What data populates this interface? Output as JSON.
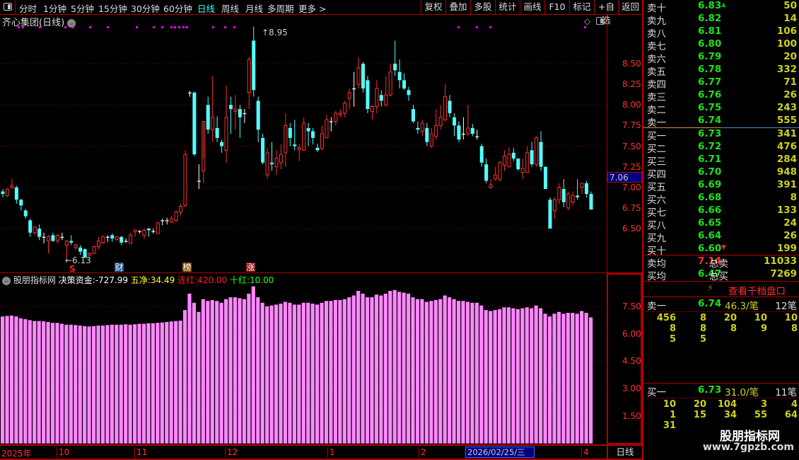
{
  "toolbar": {
    "periods": [
      "分时",
      "1分钟",
      "5分钟",
      "15分钟",
      "30分钟",
      "60分钟",
      "日线",
      "周线",
      "月线",
      "多周期",
      "更多 >"
    ],
    "active_period": "日线",
    "buttons": [
      "复权",
      "叠加",
      "多股",
      "统计",
      "画线",
      "F10",
      "标记",
      "+自选",
      "返回"
    ]
  },
  "chart": {
    "title": "齐心集团(日线)",
    "high_label": "8.95",
    "low_label": "6.13",
    "current_price_tag": "7.06",
    "price_ticks": [
      "8.50",
      "8.25",
      "8.00",
      "7.75",
      "7.50",
      "7.25",
      "7.00",
      "6.75",
      "6.50"
    ],
    "markers": [
      {
        "text": "S",
        "color": "#ff2020"
      },
      {
        "text": "财",
        "color": "#1a4f8a"
      },
      {
        "text": "榜",
        "color": "#8a4a10"
      },
      {
        "text": "涨",
        "color": "#8a1010"
      }
    ],
    "up_color": "#ff3030",
    "down_color": "#54ffff",
    "doji_color": "#ffffff",
    "signal_dot_color": "#ff00ff"
  },
  "chart_data": {
    "type": "candlestick",
    "ylim": [
      6.13,
      8.95
    ],
    "ohlc": [
      [
        6.95,
        6.98,
        6.88,
        6.92
      ],
      [
        6.9,
        6.99,
        6.88,
        6.98
      ],
      [
        7.0,
        7.1,
        6.98,
        7.02
      ],
      [
        7.0,
        7.02,
        6.8,
        6.85
      ],
      [
        6.85,
        6.86,
        6.72,
        6.78
      ],
      [
        6.72,
        6.74,
        6.62,
        6.65
      ],
      [
        6.6,
        6.62,
        6.4,
        6.45
      ],
      [
        6.45,
        6.53,
        6.42,
        6.52
      ],
      [
        6.5,
        6.55,
        6.36,
        6.4
      ],
      [
        6.4,
        6.45,
        6.32,
        6.4
      ],
      [
        6.35,
        6.42,
        6.2,
        6.4
      ],
      [
        6.42,
        6.45,
        6.34,
        6.35
      ],
      [
        6.35,
        6.43,
        6.32,
        6.42
      ],
      [
        6.4,
        6.45,
        6.36,
        6.4
      ],
      [
        6.3,
        6.36,
        6.13,
        6.35
      ],
      [
        6.35,
        6.42,
        6.3,
        6.33
      ],
      [
        6.27,
        6.32,
        6.24,
        6.3
      ],
      [
        6.27,
        6.3,
        6.18,
        6.22
      ],
      [
        6.25,
        6.26,
        6.14,
        6.15
      ],
      [
        6.18,
        6.21,
        6.15,
        6.2
      ],
      [
        6.2,
        6.29,
        6.19,
        6.28
      ],
      [
        6.28,
        6.4,
        6.25,
        6.35
      ],
      [
        6.33,
        6.42,
        6.31,
        6.4
      ],
      [
        6.4,
        6.42,
        6.34,
        6.4
      ],
      [
        6.42,
        6.44,
        6.34,
        6.38
      ],
      [
        6.37,
        6.41,
        6.35,
        6.4
      ],
      [
        6.4,
        6.41,
        6.3,
        6.33
      ],
      [
        6.35,
        6.38,
        6.33,
        6.35
      ],
      [
        6.32,
        6.45,
        6.32,
        6.42
      ],
      [
        6.46,
        6.49,
        6.4,
        6.48
      ],
      [
        6.47,
        6.48,
        6.44,
        6.47
      ],
      [
        6.42,
        6.5,
        6.37,
        6.48
      ],
      [
        6.5,
        6.51,
        6.4,
        6.48
      ],
      [
        6.47,
        6.5,
        6.44,
        6.47
      ],
      [
        6.44,
        6.58,
        6.44,
        6.57
      ],
      [
        6.6,
        6.62,
        6.54,
        6.6
      ],
      [
        6.6,
        6.63,
        6.55,
        6.6
      ],
      [
        6.58,
        6.65,
        6.57,
        6.62
      ],
      [
        6.6,
        6.72,
        6.58,
        6.7
      ],
      [
        6.7,
        6.8,
        6.66,
        6.77
      ],
      [
        6.78,
        7.45,
        6.76,
        7.4
      ],
      [
        8.15,
        8.17,
        8.1,
        8.15
      ],
      [
        8.15,
        8.16,
        7.38,
        7.4
      ],
      [
        7.08,
        7.28,
        6.98,
        7.08
      ],
      [
        7.2,
        7.35,
        7.05,
        7.8
      ],
      [
        8.0,
        8.1,
        7.65,
        7.7
      ],
      [
        7.7,
        8.35,
        7.55,
        7.85
      ],
      [
        7.72,
        7.86,
        7.55,
        7.6
      ],
      [
        7.55,
        7.58,
        7.42,
        7.5
      ],
      [
        7.45,
        8.23,
        7.3,
        7.85
      ],
      [
        8.0,
        8.1,
        7.65,
        7.95
      ],
      [
        7.92,
        8.12,
        7.7,
        7.95
      ],
      [
        7.95,
        8.0,
        7.6,
        7.85
      ],
      [
        7.9,
        7.95,
        7.78,
        7.9
      ],
      [
        8.15,
        8.58,
        7.95,
        8.55
      ],
      [
        8.78,
        8.95,
        8.1,
        8.18
      ],
      [
        8.05,
        8.1,
        7.55,
        7.7
      ],
      [
        7.6,
        7.65,
        7.28,
        7.3
      ],
      [
        7.15,
        7.48,
        7.1,
        7.42
      ],
      [
        7.3,
        7.55,
        7.2,
        7.28
      ],
      [
        7.25,
        7.45,
        7.15,
        7.35
      ],
      [
        7.3,
        7.52,
        7.22,
        7.4
      ],
      [
        7.42,
        7.9,
        7.25,
        7.75
      ],
      [
        7.72,
        7.78,
        7.5,
        7.6
      ],
      [
        7.52,
        7.82,
        7.45,
        7.5
      ],
      [
        7.46,
        7.52,
        7.32,
        7.48
      ],
      [
        7.45,
        7.85,
        7.45,
        7.78
      ],
      [
        7.72,
        7.78,
        7.5,
        7.68
      ],
      [
        7.68,
        7.72,
        7.52,
        7.6
      ],
      [
        7.48,
        7.53,
        7.43,
        7.45
      ],
      [
        7.47,
        7.75,
        7.45,
        7.65
      ],
      [
        7.6,
        7.88,
        7.6,
        7.82
      ],
      [
        7.8,
        7.85,
        7.68,
        7.8
      ],
      [
        7.8,
        7.93,
        7.75,
        7.9
      ],
      [
        7.88,
        7.95,
        7.85,
        7.9
      ],
      [
        7.9,
        8.05,
        7.85,
        8.02
      ],
      [
        8.08,
        8.2,
        7.95,
        8.15
      ],
      [
        8.2,
        8.4,
        7.98,
        8.2
      ],
      [
        8.25,
        8.58,
        8.2,
        8.45
      ],
      [
        8.5,
        8.52,
        8.15,
        8.2
      ],
      [
        8.3,
        8.35,
        7.9,
        7.95
      ],
      [
        7.92,
        8.0,
        7.82,
        7.98
      ],
      [
        7.98,
        8.3,
        7.9,
        8.2
      ],
      [
        8.12,
        8.18,
        7.98,
        8.05
      ],
      [
        8.0,
        8.35,
        7.98,
        8.12
      ],
      [
        8.12,
        8.5,
        8.1,
        8.4
      ],
      [
        8.5,
        8.78,
        8.35,
        8.42
      ],
      [
        8.4,
        8.55,
        8.2,
        8.3
      ],
      [
        8.3,
        8.38,
        8.18,
        8.2
      ],
      [
        8.18,
        8.22,
        8.05,
        8.12
      ],
      [
        7.95,
        8.0,
        7.78,
        7.8
      ],
      [
        7.72,
        7.8,
        7.65,
        7.7
      ],
      [
        7.68,
        7.82,
        7.62,
        7.78
      ],
      [
        7.72,
        7.78,
        7.5,
        7.55
      ],
      [
        7.5,
        7.72,
        7.48,
        7.65
      ],
      [
        7.62,
        7.95,
        7.58,
        7.75
      ],
      [
        7.75,
        8.0,
        7.7,
        7.85
      ],
      [
        7.82,
        8.25,
        7.8,
        8.1
      ],
      [
        8.05,
        8.12,
        7.85,
        7.9
      ],
      [
        7.85,
        7.9,
        7.62,
        7.75
      ],
      [
        7.75,
        7.8,
        7.55,
        7.58
      ],
      [
        7.65,
        7.85,
        7.58,
        7.65
      ],
      [
        7.65,
        8.0,
        7.62,
        7.72
      ],
      [
        7.72,
        7.77,
        7.62,
        7.65
      ],
      [
        7.62,
        7.7,
        7.58,
        7.62
      ],
      [
        7.5,
        7.53,
        7.25,
        7.3
      ],
      [
        7.28,
        7.35,
        7.05,
        7.08
      ],
      [
        7.0,
        7.1,
        6.98,
        7.03
      ],
      [
        7.1,
        7.25,
        7.08,
        7.15
      ],
      [
        7.1,
        7.32,
        7.07,
        7.3
      ],
      [
        7.27,
        7.45,
        7.2,
        7.38
      ],
      [
        7.25,
        7.48,
        7.24,
        7.4
      ],
      [
        7.42,
        7.48,
        7.32,
        7.35
      ],
      [
        7.35,
        7.35,
        7.2,
        7.22
      ],
      [
        7.18,
        7.35,
        7.1,
        7.23
      ],
      [
        7.18,
        7.5,
        7.18,
        7.42
      ],
      [
        7.45,
        7.55,
        7.25,
        7.28
      ],
      [
        7.28,
        7.62,
        7.25,
        7.6
      ],
      [
        7.55,
        7.68,
        7.2,
        7.25
      ],
      [
        7.25,
        7.25,
        6.98,
        6.98
      ],
      [
        6.85,
        6.88,
        6.5,
        6.5
      ],
      [
        6.72,
        6.88,
        6.62,
        6.85
      ],
      [
        6.85,
        7.05,
        6.8,
        7.0
      ],
      [
        6.98,
        7.1,
        6.76,
        6.82
      ],
      [
        6.75,
        6.95,
        6.72,
        6.92
      ],
      [
        6.82,
        6.95,
        6.78,
        6.9
      ],
      [
        6.9,
        7.1,
        6.85,
        6.88
      ],
      [
        7.0,
        7.05,
        6.92,
        7.05
      ],
      [
        7.05,
        7.08,
        6.88,
        6.92
      ],
      [
        6.92,
        6.95,
        6.73,
        6.73
      ]
    ],
    "indicator": {
      "type": "bar",
      "color": "#ff88ff",
      "ticks": [
        "7.50",
        "6.00",
        "4.50",
        "3.00",
        "1.50"
      ],
      "values": [
        6.95,
        6.98,
        7.0,
        6.95,
        6.85,
        6.8,
        6.75,
        6.7,
        6.7,
        6.68,
        6.65,
        6.6,
        6.6,
        6.55,
        6.5,
        6.5,
        6.48,
        6.45,
        6.42,
        6.4,
        6.42,
        6.45,
        6.45,
        6.48,
        6.5,
        6.5,
        6.5,
        6.52,
        6.5,
        6.52,
        6.55,
        6.55,
        6.58,
        6.58,
        6.6,
        6.62,
        6.65,
        6.68,
        6.7,
        6.72,
        7.3,
        8.2,
        7.7,
        7.2,
        7.9,
        7.8,
        7.85,
        7.8,
        7.7,
        7.9,
        8.0,
        8.0,
        7.95,
        7.9,
        8.2,
        8.6,
        8.0,
        7.7,
        7.5,
        7.55,
        7.6,
        7.65,
        7.75,
        7.7,
        7.6,
        7.6,
        7.7,
        7.7,
        7.65,
        7.6,
        7.7,
        7.8,
        7.8,
        7.85,
        7.85,
        7.9,
        8.0,
        8.1,
        8.35,
        8.2,
        8.0,
        8.0,
        8.15,
        8.1,
        8.2,
        8.35,
        8.4,
        8.3,
        8.25,
        8.2,
        8.0,
        7.9,
        7.9,
        7.75,
        7.8,
        7.85,
        7.9,
        8.1,
        8.0,
        7.9,
        7.8,
        7.8,
        7.75,
        7.7,
        7.7,
        7.55,
        7.3,
        7.25,
        7.3,
        7.35,
        7.45,
        7.45,
        7.4,
        7.35,
        7.4,
        7.45,
        7.4,
        7.55,
        7.4,
        7.1,
        6.95,
        7.1,
        7.2,
        7.1,
        7.15,
        7.15,
        7.1,
        7.25,
        7.15,
        6.9
      ]
    }
  },
  "indicator_header": {
    "name": "股朋指标网",
    "f1_label": "决策资金:",
    "f1_value": "-727.99",
    "f2_label": "五净:",
    "f2_value": "34.49",
    "f3_label": "连红:",
    "f3_value": "420.00",
    "f4_label": "十红:",
    "f4_value": "10.00"
  },
  "xaxis": {
    "labels": [
      "2025年",
      "10",
      "11",
      "12",
      "1",
      "2",
      "4"
    ],
    "cursor_date": "2026/02/25/三",
    "period": "日线"
  },
  "orderbook": {
    "asks": [
      {
        "label": "卖十",
        "price": "6.83",
        "vol": "50"
      },
      {
        "label": "卖九",
        "price": "6.82",
        "vol": "14"
      },
      {
        "label": "卖八",
        "price": "6.81",
        "vol": "106"
      },
      {
        "label": "卖七",
        "price": "6.80",
        "vol": "100"
      },
      {
        "label": "卖六",
        "price": "6.79",
        "vol": "20"
      },
      {
        "label": "卖五",
        "price": "6.78",
        "vol": "332"
      },
      {
        "label": "卖四",
        "price": "6.77",
        "vol": "71"
      },
      {
        "label": "卖三",
        "price": "6.76",
        "vol": "26"
      },
      {
        "label": "卖二",
        "price": "6.75",
        "vol": "243"
      },
      {
        "label": "卖一",
        "price": "6.74",
        "vol": "555"
      }
    ],
    "bids": [
      {
        "label": "买一",
        "price": "6.73",
        "vol": "341"
      },
      {
        "label": "买二",
        "price": "6.72",
        "vol": "476"
      },
      {
        "label": "买三",
        "price": "6.71",
        "vol": "284"
      },
      {
        "label": "买四",
        "price": "6.70",
        "vol": "948"
      },
      {
        "label": "买五",
        "price": "6.69",
        "vol": "391"
      },
      {
        "label": "买六",
        "price": "6.68",
        "vol": "8"
      },
      {
        "label": "买七",
        "price": "6.66",
        "vol": "133"
      },
      {
        "label": "买八",
        "price": "6.65",
        "vol": "24"
      },
      {
        "label": "买九",
        "price": "6.64",
        "vol": "26"
      },
      {
        "label": "买十",
        "price": "6.60",
        "vol": "199"
      }
    ],
    "sell_avg_label": "卖均",
    "sell_avg": "7.14",
    "total_sell_label": "总卖",
    "total_sell": "11033",
    "buy_avg_label": "买均",
    "buy_avg": "6.47",
    "total_buy_label": "总买",
    "total_buy": "7269",
    "depth_link": "查看千档盘口",
    "ask1": {
      "label": "卖一",
      "price": "6.74",
      "per": "46.3/笔",
      "count": "12笔",
      "queue": [
        "456",
        "8",
        "20",
        "10",
        "10",
        "8",
        "8",
        "8",
        "9",
        "8",
        "5",
        "5"
      ]
    },
    "bid1": {
      "label": "买一",
      "price": "6.73",
      "per": "31.0/笔",
      "count": "11笔",
      "queue": [
        "10",
        "20",
        "104",
        "3",
        "4",
        "1",
        "15",
        "34",
        "55",
        "64",
        "31"
      ]
    }
  },
  "watermark": {
    "name": "股朋指标网",
    "url": "www.7gpzb.com"
  }
}
